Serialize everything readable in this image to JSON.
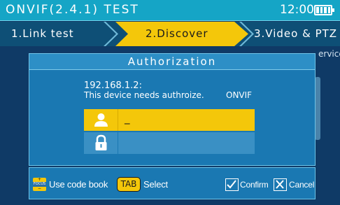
{
  "header": {
    "title": "ONVIF(2.4.1) TEST",
    "time": "12:00"
  },
  "steps": [
    {
      "label": "1.Link test",
      "active": false
    },
    {
      "label": "2.Discover",
      "active": true
    },
    {
      "label": "3.Video & PTZ",
      "active": false
    }
  ],
  "background": {
    "partial_text": "ervice"
  },
  "dialog": {
    "title": "Authorization",
    "device_ip": "192.168.1.2:",
    "message": "This device needs authroize.",
    "protocol": "ONVIF",
    "username_value": "_",
    "password_value": ""
  },
  "footer": {
    "focus_key": {
      "top": "+",
      "middle": "FOCUS",
      "bottom": "−"
    },
    "codebook_label": "Use code book",
    "tab_key": "TAB",
    "select_label": "Select",
    "confirm_label": "Confirm",
    "cancel_label": "Cancel"
  },
  "colors": {
    "accent_yellow": "#f4c70a",
    "header_cyan": "#15a5c6",
    "dialog_blue": "#1a78b2",
    "background_navy": "#0f3a66"
  },
  "icons": [
    "battery-icon",
    "user-icon",
    "lock-icon",
    "focus-key-icon",
    "tab-key-icon",
    "checkbox-checked-icon",
    "checkbox-x-icon"
  ]
}
